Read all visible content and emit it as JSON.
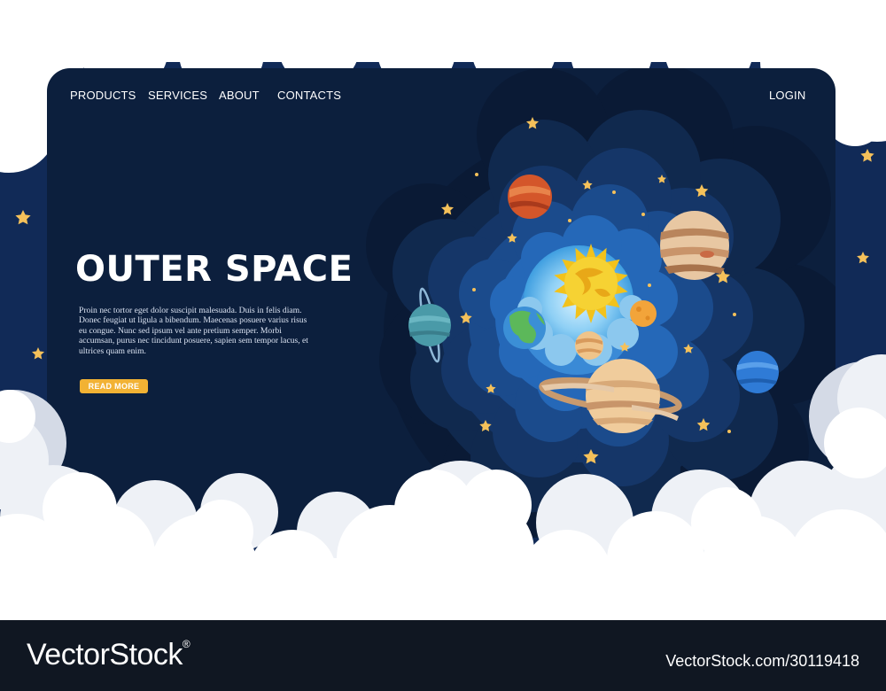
{
  "nav": {
    "products": "PRODUCTS",
    "services": "SERVICES",
    "about": "ABOUT",
    "contacts": "CONTACTS",
    "login": "LOGIN"
  },
  "hero": {
    "title": "OUTER SPACE",
    "body": "Proin nec tortor eget dolor suscipit malesuada. Duis in felis diam. Donec feugiat ut ligula a bibendum. Maecenas posuere varius risus eu congue. Nunc sed ipsum vel ante pretium semper. Morbi accumsan, purus nec tincidunt posuere, sapien sem tempor lacus, et ultrices quam enim.",
    "button": "READ MORE"
  },
  "illustration": {
    "objects": [
      "sun-icon",
      "mercury-icon",
      "venus-icon",
      "earth-icon",
      "mars-icon",
      "jupiter-icon",
      "saturn-icon",
      "uranus-icon",
      "neptune-icon",
      "star-icon"
    ]
  },
  "colors": {
    "page_bg": "#112a57",
    "site_bg": "#0c1f3d",
    "accent": "#f2b234",
    "star": "#f5c15a",
    "cloud": "#ffffff",
    "footer_bg": "#101722"
  },
  "watermark": {
    "brand": "VectorStock",
    "registered": "®",
    "id": "VectorStock.com/30119418"
  }
}
